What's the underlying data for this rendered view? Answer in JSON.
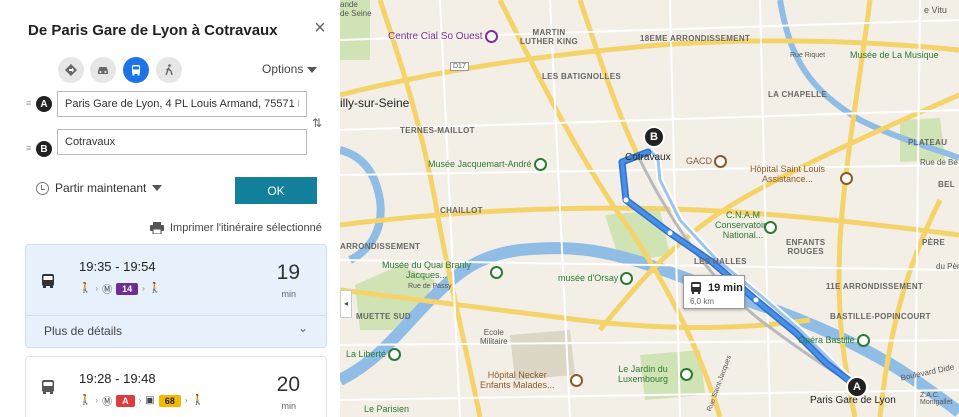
{
  "panel": {
    "title": "De Paris Gare de Lyon à Cotravaux",
    "close_glyph": "×",
    "modes": [
      {
        "name": "itinerary-mode",
        "icon": "diamond-arrow-icon",
        "active": false
      },
      {
        "name": "car-mode",
        "icon": "car-icon",
        "active": false
      },
      {
        "name": "transit-mode",
        "icon": "bus-icon",
        "active": true
      },
      {
        "name": "walk-mode",
        "icon": "walk-icon",
        "active": false
      }
    ],
    "options_label": "Options",
    "origin": {
      "marker": "A",
      "value": "Paris Gare de Lyon, 4 PL Louis Armand, 75571 Pa"
    },
    "destination": {
      "marker": "B",
      "value": "Cotravaux"
    },
    "swap_glyph": "⇅",
    "depart_label": "Partir maintenant",
    "ok_label": "OK",
    "print_label": "Imprimer l'itinéraire sélectionné",
    "routes": [
      {
        "times": "19:35 - 19:54",
        "duration": "19",
        "unit": "min",
        "lines": [
          {
            "label": "14",
            "color": "#6d2f8f",
            "text_color": "#ffffff"
          }
        ],
        "details_label": "Plus de détails"
      },
      {
        "times": "19:28 - 19:48",
        "duration": "20",
        "unit": "min",
        "lines": [
          {
            "label": "A",
            "color": "#e03a3e",
            "text_color": "#ffffff"
          },
          {
            "label": "68",
            "color": "#f5b800",
            "text_color": "#222222"
          }
        ]
      }
    ]
  },
  "map": {
    "collapse_glyph": "◂",
    "route_color": "#4a90e2",
    "duration_box": {
      "time": "19 min",
      "distance": "6,0 km"
    },
    "pins": {
      "a": "A",
      "b": "B"
    },
    "labels": {
      "centre_cial": "Centre Cial So Ouest",
      "martin_luther": "MARTIN\nLUTHER KING",
      "arr18": "18EME ARRONDISSEMENT",
      "musee_musique": "Musée de La Musique",
      "batignolles": "LES BATIGNOLLES",
      "rue_riquet": "Rue Riquet",
      "la_chapelle": "LA CHAPELLE",
      "illy": "illy-sur-Seine",
      "ternes": "TERNES-MAILLOT",
      "plateau": "PLATEAU",
      "cotravaux": "Cotravaux",
      "gacd": "GACD",
      "jacquemart": "Musée Jacquemart-André",
      "hopital_st_louis": "Hôpital Saint Louis\nAssistance...",
      "chaillot": "CHAILLOT",
      "cnam": "C.N.A.M\nConservatoire\nNational...",
      "enfants_rouges": "ENFANTS\nROUGES",
      "arrondissement": "ARRONDISSEMENT",
      "quai_branly": "Musée du Quai Branly\nJacques...",
      "orsay": "musée d'Orsay",
      "halles": "LES HALLES",
      "arr11": "11E ARRONDISSEMENT",
      "muette": "MUETTE SUD",
      "ecole": "Ecole\nMilitaire",
      "bastille_pop": "BASTILLE-POPINCOURT",
      "opera_bastille": "Opéra Bastille",
      "la_liberte": "La Liberté",
      "necker": "Hôpital Necker\nEnfants Malades...",
      "luxembourg": "Le Jardin du\nLuxembourg",
      "gare_lyon": "Paris Gare de Lyon",
      "parisien": "Le Parisien",
      "zac": "Z.A.C.\nMontgallet",
      "boulevard": "Boulevard Dide",
      "pere": "PÈRE",
      "bel": "BEL",
      "du_pere": "du Père",
      "rue_de_be": "Rue de Be",
      "vitu": "e Vitu",
      "seine_top": "ande\nde Seine",
      "d17": "D17",
      "rue_passy": "Rue de Passy",
      "rue_st_jacques": "Rue Saint-Jacques"
    }
  }
}
